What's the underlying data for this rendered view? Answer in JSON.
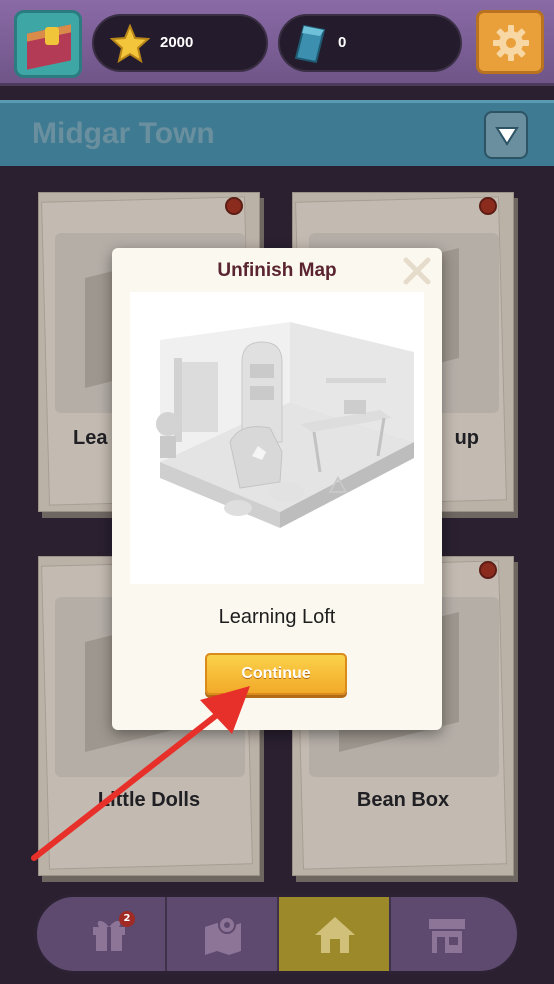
{
  "topbar": {
    "stars": "2000",
    "gems": "0",
    "avatar_icon": "room-avatar-icon",
    "star_icon": "star-icon",
    "gem_icon": "gem-icon",
    "settings_icon": "gear-icon"
  },
  "town": {
    "title": "Midgar Town",
    "dropdown_icon": "chevron-down-icon"
  },
  "cards": [
    {
      "label": "Lea"
    },
    {
      "label": "up"
    },
    {
      "label": "Little Dolls"
    },
    {
      "label": "Bean Box"
    }
  ],
  "modal": {
    "title": "Unfinish Map",
    "map_name": "Learning Loft",
    "continue_label": "Continue",
    "close_icon": "close-icon"
  },
  "nav": {
    "gift_badge": "2",
    "tabs": [
      "gift-icon",
      "map-icon",
      "home-icon",
      "shop-icon"
    ],
    "active_tab": "home-icon"
  },
  "colors": {
    "background": "#2a2030",
    "accent": "#f2a92a",
    "modal_title": "#5a2430",
    "arrow": "#e8302a"
  }
}
